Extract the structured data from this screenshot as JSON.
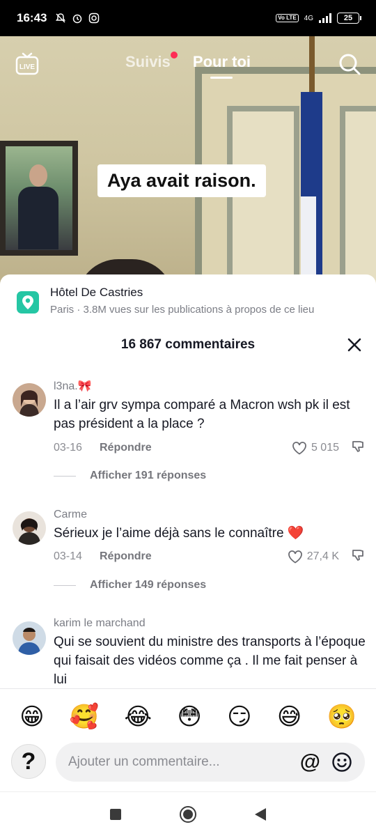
{
  "status_bar": {
    "time": "16:43",
    "network": "4G",
    "volte": "Vo LTE",
    "battery": "25"
  },
  "video": {
    "caption": "Aya avait raison.",
    "tabs": {
      "following": "Suivis",
      "for_you": "Pour toi"
    },
    "live_label": "LIVE"
  },
  "location": {
    "name": "Hôtel De Castries",
    "subtitle": "Paris · 3.8M vues sur les publications à propos de ce lieu",
    "icon": "map-pin-icon",
    "color": "#25c6a4"
  },
  "comments_header": {
    "count_label": "16 867 commentaires"
  },
  "comments": [
    {
      "username": "l3na.🎀",
      "text": "Il a l’air grv sympa comparé a Macron wsh pk il est pas président a la place ?",
      "date": "03-16",
      "reply_label": "Répondre",
      "likes": "5 015",
      "replies_label": "Afficher 191 réponses"
    },
    {
      "username": "Carme",
      "text": "Sérieux je l’aime déjà sans le connaître ❤️",
      "date": "03-14",
      "reply_label": "Répondre",
      "likes": "27,4 K",
      "replies_label": "Afficher 149 réponses"
    },
    {
      "username": "karim le marchand",
      "text": "Qui se souvient du ministre des transports à l’époque qui faisait des vidéos comme ça . Il me fait penser à lui"
    }
  ],
  "emoji_bar": [
    "😁",
    "🥰",
    "😂",
    "😳",
    "😏",
    "😅",
    "🥺"
  ],
  "composer": {
    "placeholder": "Ajouter un commentaire...",
    "avatar_glyph": "?",
    "mention_glyph": "@"
  },
  "colors": {
    "accent": "#fe2c55",
    "text_primary": "#161823",
    "text_secondary": "#7b7d85"
  }
}
